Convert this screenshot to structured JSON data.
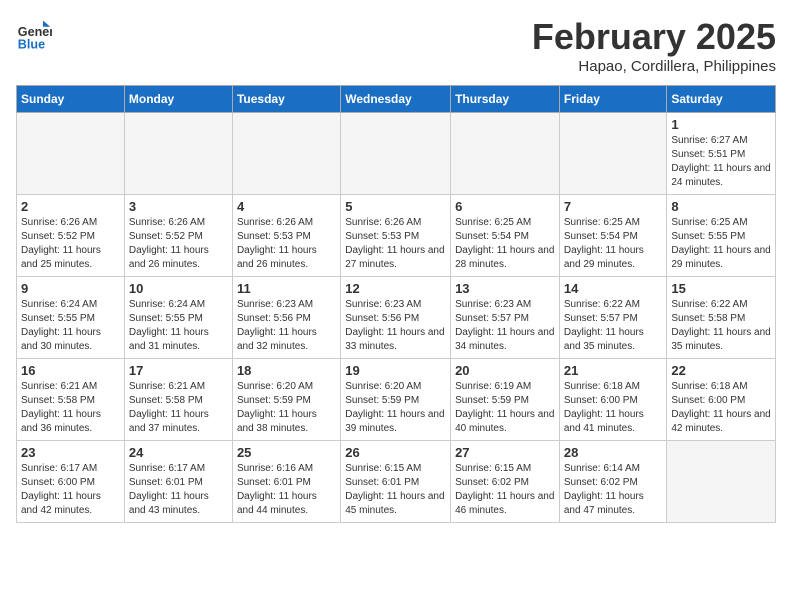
{
  "header": {
    "logo_general": "General",
    "logo_blue": "Blue",
    "month_title": "February 2025",
    "location": "Hapao, Cordillera, Philippines"
  },
  "days_of_week": [
    "Sunday",
    "Monday",
    "Tuesday",
    "Wednesday",
    "Thursday",
    "Friday",
    "Saturday"
  ],
  "weeks": [
    [
      {
        "day": "",
        "info": ""
      },
      {
        "day": "",
        "info": ""
      },
      {
        "day": "",
        "info": ""
      },
      {
        "day": "",
        "info": ""
      },
      {
        "day": "",
        "info": ""
      },
      {
        "day": "",
        "info": ""
      },
      {
        "day": "1",
        "info": "Sunrise: 6:27 AM\nSunset: 5:51 PM\nDaylight: 11 hours and 24 minutes."
      }
    ],
    [
      {
        "day": "2",
        "info": "Sunrise: 6:26 AM\nSunset: 5:52 PM\nDaylight: 11 hours and 25 minutes."
      },
      {
        "day": "3",
        "info": "Sunrise: 6:26 AM\nSunset: 5:52 PM\nDaylight: 11 hours and 26 minutes."
      },
      {
        "day": "4",
        "info": "Sunrise: 6:26 AM\nSunset: 5:53 PM\nDaylight: 11 hours and 26 minutes."
      },
      {
        "day": "5",
        "info": "Sunrise: 6:26 AM\nSunset: 5:53 PM\nDaylight: 11 hours and 27 minutes."
      },
      {
        "day": "6",
        "info": "Sunrise: 6:25 AM\nSunset: 5:54 PM\nDaylight: 11 hours and 28 minutes."
      },
      {
        "day": "7",
        "info": "Sunrise: 6:25 AM\nSunset: 5:54 PM\nDaylight: 11 hours and 29 minutes."
      },
      {
        "day": "8",
        "info": "Sunrise: 6:25 AM\nSunset: 5:55 PM\nDaylight: 11 hours and 29 minutes."
      }
    ],
    [
      {
        "day": "9",
        "info": "Sunrise: 6:24 AM\nSunset: 5:55 PM\nDaylight: 11 hours and 30 minutes."
      },
      {
        "day": "10",
        "info": "Sunrise: 6:24 AM\nSunset: 5:55 PM\nDaylight: 11 hours and 31 minutes."
      },
      {
        "day": "11",
        "info": "Sunrise: 6:23 AM\nSunset: 5:56 PM\nDaylight: 11 hours and 32 minutes."
      },
      {
        "day": "12",
        "info": "Sunrise: 6:23 AM\nSunset: 5:56 PM\nDaylight: 11 hours and 33 minutes."
      },
      {
        "day": "13",
        "info": "Sunrise: 6:23 AM\nSunset: 5:57 PM\nDaylight: 11 hours and 34 minutes."
      },
      {
        "day": "14",
        "info": "Sunrise: 6:22 AM\nSunset: 5:57 PM\nDaylight: 11 hours and 35 minutes."
      },
      {
        "day": "15",
        "info": "Sunrise: 6:22 AM\nSunset: 5:58 PM\nDaylight: 11 hours and 35 minutes."
      }
    ],
    [
      {
        "day": "16",
        "info": "Sunrise: 6:21 AM\nSunset: 5:58 PM\nDaylight: 11 hours and 36 minutes."
      },
      {
        "day": "17",
        "info": "Sunrise: 6:21 AM\nSunset: 5:58 PM\nDaylight: 11 hours and 37 minutes."
      },
      {
        "day": "18",
        "info": "Sunrise: 6:20 AM\nSunset: 5:59 PM\nDaylight: 11 hours and 38 minutes."
      },
      {
        "day": "19",
        "info": "Sunrise: 6:20 AM\nSunset: 5:59 PM\nDaylight: 11 hours and 39 minutes."
      },
      {
        "day": "20",
        "info": "Sunrise: 6:19 AM\nSunset: 5:59 PM\nDaylight: 11 hours and 40 minutes."
      },
      {
        "day": "21",
        "info": "Sunrise: 6:18 AM\nSunset: 6:00 PM\nDaylight: 11 hours and 41 minutes."
      },
      {
        "day": "22",
        "info": "Sunrise: 6:18 AM\nSunset: 6:00 PM\nDaylight: 11 hours and 42 minutes."
      }
    ],
    [
      {
        "day": "23",
        "info": "Sunrise: 6:17 AM\nSunset: 6:00 PM\nDaylight: 11 hours and 42 minutes."
      },
      {
        "day": "24",
        "info": "Sunrise: 6:17 AM\nSunset: 6:01 PM\nDaylight: 11 hours and 43 minutes."
      },
      {
        "day": "25",
        "info": "Sunrise: 6:16 AM\nSunset: 6:01 PM\nDaylight: 11 hours and 44 minutes."
      },
      {
        "day": "26",
        "info": "Sunrise: 6:15 AM\nSunset: 6:01 PM\nDaylight: 11 hours and 45 minutes."
      },
      {
        "day": "27",
        "info": "Sunrise: 6:15 AM\nSunset: 6:02 PM\nDaylight: 11 hours and 46 minutes."
      },
      {
        "day": "28",
        "info": "Sunrise: 6:14 AM\nSunset: 6:02 PM\nDaylight: 11 hours and 47 minutes."
      },
      {
        "day": "",
        "info": ""
      }
    ]
  ]
}
